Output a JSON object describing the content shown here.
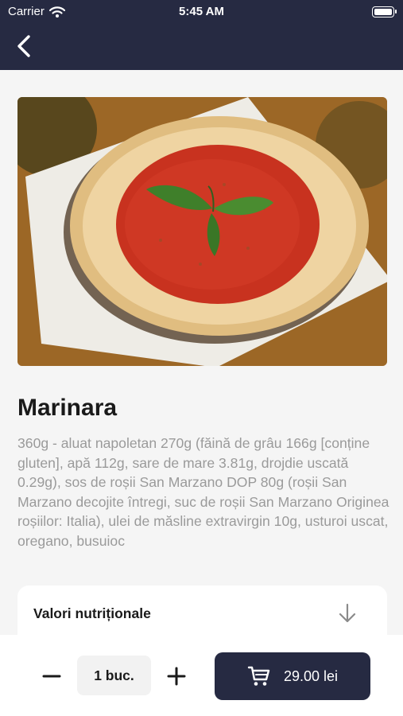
{
  "status_bar": {
    "carrier": "Carrier",
    "time": "5:45 AM",
    "battery_level": 1.0
  },
  "header": {
    "back_icon": "chevron-left-icon"
  },
  "product": {
    "image_alt": "pizza",
    "name": "Marinara",
    "description": "360g - aluat napoletan 270g (făină de grâu 166g [conține gluten], apă 112g, sare de mare 3.81g, drojdie uscată 0.29g), sos de roșii San Marzano DOP 80g (roșii San Marzano decojite întregi, suc de roșii San Marzano Originea roșiilor: Italia), ulei de măsline extravirgin 10g, usturoi uscat, oregano, busuioc"
  },
  "nutrition": {
    "label": "Valori nutriționale",
    "icon": "arrow-down-icon"
  },
  "order": {
    "quantity_label": "1 buc.",
    "price_label": "29.00 lei",
    "cart_icon": "cart-icon"
  },
  "colors": {
    "primary": "#262a42",
    "background": "#f5f5f5",
    "muted_text": "#9a9a9a"
  }
}
